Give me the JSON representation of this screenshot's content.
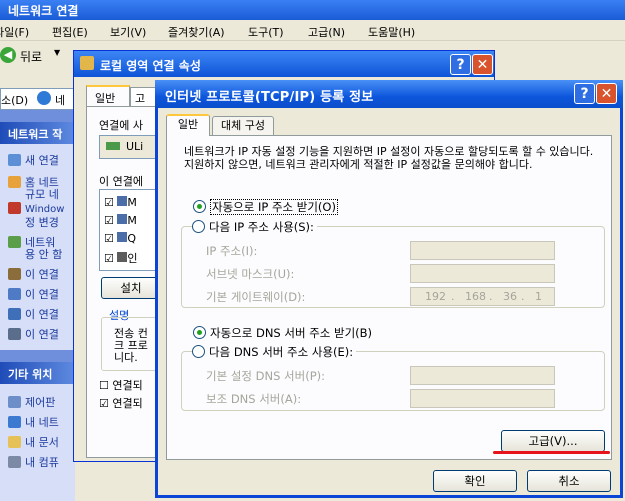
{
  "explorer": {
    "title": "네트워크 연결",
    "menu": [
      "파일(F)",
      "편집(E)",
      "보기(V)",
      "즐겨찾기(A)",
      "도구(T)",
      "고급(N)",
      "도움말(H)"
    ],
    "back_label": "뒤로",
    "address_text": "소(D)",
    "network_tasks_header": "네트워크 작",
    "tasks": [
      "새 연결",
      "홈 네트",
      "규모 네",
      "Window",
      "정 변경",
      "네트워",
      "용 안 함",
      "이 연결",
      "이 연결",
      "이 연결",
      "이 연결"
    ],
    "other_places_header": "기타 위치",
    "places": [
      "제어판",
      "내 네트",
      "내 문서",
      "내 컴퓨"
    ]
  },
  "middle_dialog": {
    "title": "로컬 영역 연결 속성",
    "tabs": [
      "일반",
      "고"
    ],
    "connect_using": "연결에 사",
    "adapter": "ULi",
    "components_label": "이 연결에",
    "components": [
      "M",
      "M",
      "Q",
      "인"
    ],
    "install_button": "설치",
    "description_label": "설명",
    "description_text": "전송 컨 크 프로 니다.",
    "checkbox1": "연결되",
    "checkbox2": "연결되"
  },
  "dialog": {
    "title": "인터넷 프로토콜(TCP/IP) 등록 정보",
    "tabs": [
      "일반",
      "대체 구성"
    ],
    "description": "네트워크가 IP 자동 설정 기능을 지원하면 IP 설정이 자동으로 할당되도록 할 수 있습니다. 지원하지 않으면, 네트워크 관리자에게 적절한 IP 설정값을 문의해야 합니다.",
    "ip_auto": "자동으로 IP 주소 받기(O)",
    "ip_manual": "다음 IP 주소 사용(S):",
    "ip_address_label": "IP 주소(I):",
    "subnet_label": "서브넷 마스크(U):",
    "gateway_label": "기본 게이트웨이(D):",
    "gateway_value": [
      "192",
      "168",
      "36",
      "1"
    ],
    "dns_auto": "자동으로 DNS 서버 주소 받기(B)",
    "dns_manual": "다음 DNS 서버 주소 사용(E):",
    "dns_preferred_label": "기본 설정 DNS 서버(P):",
    "dns_alternate_label": "보조 DNS 서버(A):",
    "advanced_button": "고급(V)...",
    "ok_button": "확인",
    "cancel_button": "취소"
  },
  "colors": {
    "title_bar": "#0d56dc",
    "highlight_underline": "#e8121a",
    "radio_dot": "#21a121"
  }
}
